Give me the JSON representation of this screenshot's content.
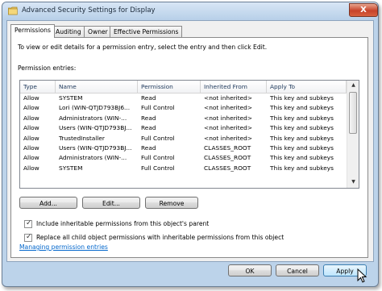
{
  "window": {
    "title": "Advanced Security Settings for Display",
    "close_glyph": "X"
  },
  "tabs": [
    {
      "label": "Permissions",
      "active": true
    },
    {
      "label": "Auditing",
      "active": false
    },
    {
      "label": "Owner",
      "active": false
    },
    {
      "label": "Effective Permissions",
      "active": false
    }
  ],
  "instructions": "To view or edit details for a permission entry, select the entry and then click Edit.",
  "entries_label": "Permission entries:",
  "columns": [
    "Type",
    "Name",
    "Permission",
    "Inherited From",
    "Apply To"
  ],
  "rows": [
    [
      "Allow",
      "SYSTEM",
      "Read",
      "<not inherited>",
      "This key and subkeys"
    ],
    [
      "Allow",
      "Lori (WIN-QTJD793BJ6...",
      "Full Control",
      "<not inherited>",
      "This key and subkeys"
    ],
    [
      "Allow",
      "Administrators (WIN-...",
      "Read",
      "<not inherited>",
      "This key and subkeys"
    ],
    [
      "Allow",
      "Users (WIN-QTJD793BJ...",
      "Read",
      "<not inherited>",
      "This key and subkeys"
    ],
    [
      "Allow",
      "TrustedInstaller",
      "Full Control",
      "<not inherited>",
      "This key and subkeys"
    ],
    [
      "Allow",
      "Users (WIN-QTJD793BJ...",
      "Read",
      "CLASSES_ROOT",
      "This key and subkeys"
    ],
    [
      "Allow",
      "Administrators (WIN-...",
      "Full Control",
      "CLASSES_ROOT",
      "This key and subkeys"
    ],
    [
      "Allow",
      "SYSTEM",
      "Full Control",
      "CLASSES_ROOT",
      "This key and subkeys"
    ]
  ],
  "buttons": {
    "add": "Add...",
    "edit": "Edit...",
    "remove": "Remove"
  },
  "checkboxes": {
    "include": {
      "label": "Include inheritable permissions from this object's parent",
      "checked": true
    },
    "replace": {
      "label": "Replace all child object permissions with inheritable permissions from this object",
      "checked": true
    }
  },
  "link": "Managing permission entries",
  "footer": {
    "ok": "OK",
    "cancel": "Cancel",
    "apply": "Apply"
  },
  "icons": {
    "folder": "folder-icon",
    "check": "✓",
    "scroll_up": "▲",
    "scroll_down": "▼"
  },
  "colors": {
    "title_bar": "#b7cfe8",
    "close": "#c7432a",
    "link": "#0066cc"
  }
}
